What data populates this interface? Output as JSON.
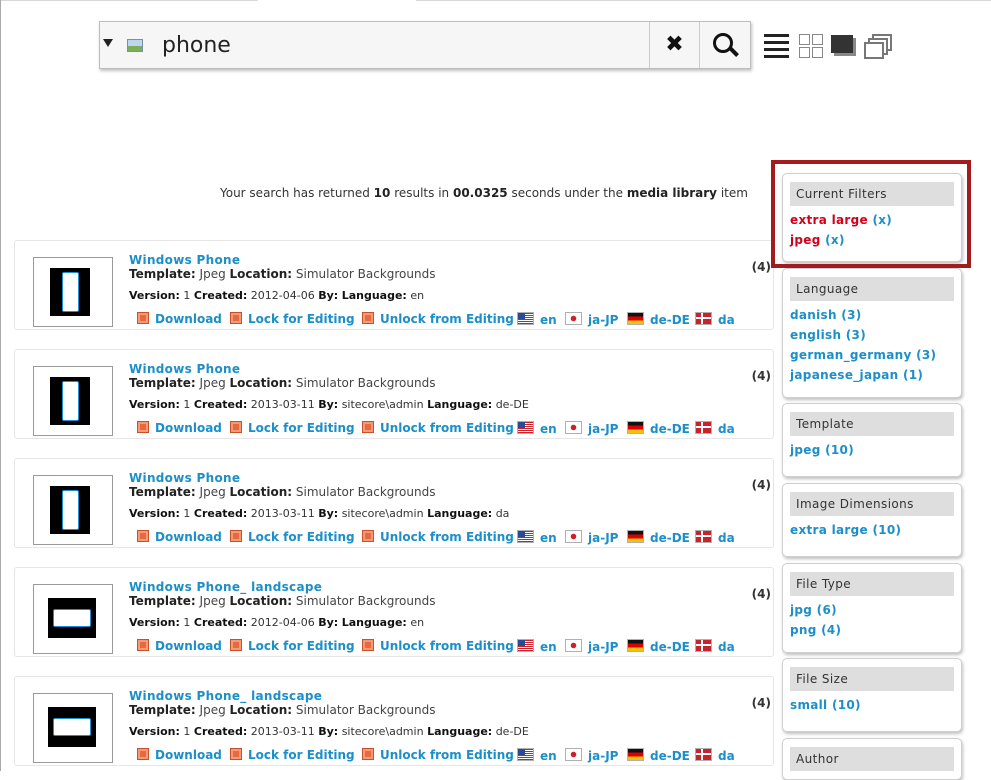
{
  "search": {
    "value": "phone",
    "clear_label": "✖"
  },
  "summary": {
    "prefix": "Your search has returned",
    "count": "10",
    "mid1": "results in",
    "seconds": "00.0325",
    "mid2": "seconds under the",
    "scope": "media library",
    "suffix": "item"
  },
  "labels": {
    "template": "Template:",
    "location": "Location:",
    "version": "Version:",
    "created": "Created:",
    "by": "By:",
    "language": "Language:"
  },
  "actions": {
    "download": "Download",
    "lock": "Lock for Editing",
    "unlock": "Unlock from Editing",
    "en": "en",
    "ja": "ja-JP",
    "de": "de-DE",
    "da": "da"
  },
  "results": [
    {
      "title": "Windows Phone",
      "template": "Jpeg",
      "location": "Simulator Backgrounds",
      "version": "1",
      "created": "2012-04-06",
      "by": "",
      "language": "en",
      "count": "(4)",
      "orientation": "portrait"
    },
    {
      "title": "Windows Phone",
      "template": "Jpeg",
      "location": "Simulator Backgrounds",
      "version": "1",
      "created": "2013-03-11",
      "by": "sitecore\\admin",
      "language": "de-DE",
      "count": "(4)",
      "orientation": "portrait"
    },
    {
      "title": "Windows Phone",
      "template": "Jpeg",
      "location": "Simulator Backgrounds",
      "version": "1",
      "created": "2013-03-11",
      "by": "sitecore\\admin",
      "language": "da",
      "count": "(4)",
      "orientation": "portrait"
    },
    {
      "title": "Windows Phone_ landscape",
      "template": "Jpeg",
      "location": "Simulator Backgrounds",
      "version": "1",
      "created": "2012-04-06",
      "by": "",
      "language": "en",
      "count": "(4)",
      "orientation": "landscape"
    },
    {
      "title": "Windows Phone_ landscape",
      "template": "Jpeg",
      "location": "Simulator Backgrounds",
      "version": "1",
      "created": "2013-03-11",
      "by": "sitecore\\admin",
      "language": "de-DE",
      "count": "(4)",
      "orientation": "landscape"
    }
  ],
  "facets": {
    "current": {
      "title": "Current Filters",
      "items": [
        {
          "label": "extra large",
          "remove": "(x)"
        },
        {
          "label": "jpeg",
          "remove": "(x)"
        }
      ]
    },
    "language": {
      "title": "Language",
      "items": [
        "danish (3)",
        "english (3)",
        "german_germany (3)",
        "japanese_japan (1)"
      ]
    },
    "template": {
      "title": "Template",
      "items": [
        "jpeg (10)"
      ]
    },
    "dimensions": {
      "title": "Image Dimensions",
      "items": [
        "extra large (10)"
      ]
    },
    "filetype": {
      "title": "File Type",
      "items": [
        "jpg (6)",
        "png (4)"
      ]
    },
    "filesize": {
      "title": "File Size",
      "items": [
        "small (10)"
      ]
    },
    "author": {
      "title": "Author"
    }
  },
  "colors": {
    "link": "#1c8fc9",
    "filter_active": "#d0021b",
    "highlight": "#a31b1e"
  }
}
